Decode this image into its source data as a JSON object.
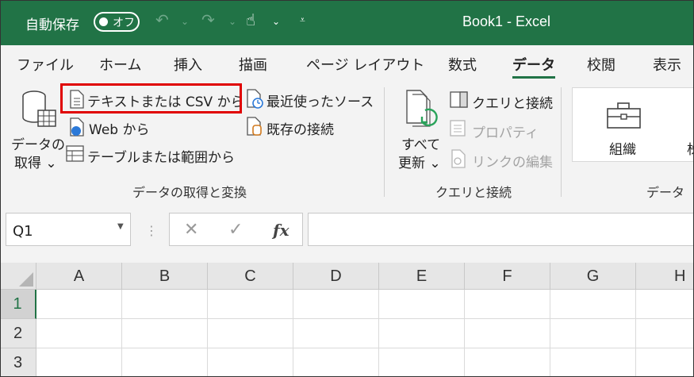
{
  "titlebar": {
    "autosave_label": "自動保存",
    "toggle_label": "オフ",
    "window_title": "Book1  -  Excel",
    "accent_color": "#217346"
  },
  "tabs": [
    "ファイル",
    "ホーム",
    "挿入",
    "描画",
    "ページ レイアウト",
    "数式",
    "データ",
    "校閲",
    "表示"
  ],
  "active_tab": "データ",
  "ribbon": {
    "get_data": {
      "line1": "データの",
      "line2": "取得 ⌄"
    },
    "from_text_csv": "テキストまたは CSV から",
    "from_web": "Web から",
    "from_table": "テーブルまたは範囲から",
    "recent_sources": "最近使ったソース",
    "existing_connections": "既存の接続",
    "group1_label": "データの取得と変換",
    "refresh_all": {
      "line1": "すべて",
      "line2": "更新 ⌄"
    },
    "queries_connections": "クエリと接続",
    "properties": "プロパティ",
    "edit_links": "リンクの編集",
    "group2_label": "クエリと接続",
    "organization": "組織",
    "group3_label": "データの"
  },
  "formula_bar": {
    "name_box": "Q1",
    "fx": "fx",
    "cancel": "✕",
    "enter": "✓"
  },
  "grid": {
    "columns": [
      "A",
      "B",
      "C",
      "D",
      "E",
      "F",
      "G",
      "H"
    ],
    "rows": [
      "1",
      "2",
      "3"
    ],
    "selected_row": "1"
  }
}
